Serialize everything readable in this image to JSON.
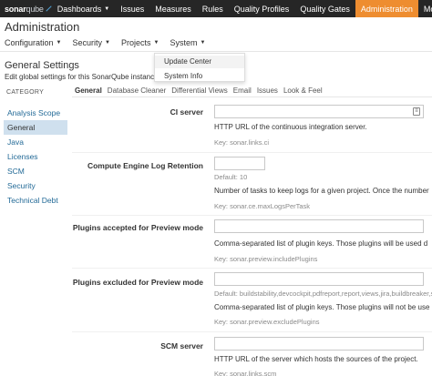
{
  "topnav": {
    "logo_main": "sonar",
    "logo_sub": "qube",
    "items": [
      {
        "label": "Dashboards",
        "caret": true
      },
      {
        "label": "Issues",
        "caret": false
      },
      {
        "label": "Measures",
        "caret": false
      },
      {
        "label": "Rules",
        "caret": false
      },
      {
        "label": "Quality Profiles",
        "caret": false
      },
      {
        "label": "Quality Gates",
        "caret": false
      },
      {
        "label": "Administration",
        "caret": false,
        "active": true
      },
      {
        "label": "More",
        "caret": true
      }
    ]
  },
  "header": {
    "title": "Administration",
    "subnav": [
      "Configuration",
      "Security",
      "Projects",
      "System"
    ]
  },
  "dropdown": {
    "items": [
      "Update Center",
      "System Info"
    ]
  },
  "settings": {
    "title": "General Settings",
    "description": "Edit global settings for this SonarQube instance."
  },
  "sidebar": {
    "category_label": "CATEGORY",
    "items": [
      "Analysis Scope",
      "General",
      "Java",
      "Licenses",
      "SCM",
      "Security",
      "Technical Debt"
    ]
  },
  "tabs": [
    "General",
    "Database Cleaner",
    "Differential Views",
    "Email",
    "Issues",
    "Look & Feel"
  ],
  "rows": [
    {
      "label": "CI server",
      "help": "HTTP URL of the continuous integration server.",
      "key": "Key: sonar.links.ci"
    },
    {
      "label": "Compute Engine Log Retention",
      "default": "Default: 10",
      "help": "Number of tasks to keep logs for a given project. Once the number",
      "key": "Key: sonar.ce.maxLogsPerTask"
    },
    {
      "label": "Plugins accepted for Preview mode",
      "help": "Comma-separated list of plugin keys. Those plugins will be used d",
      "key": "Key: sonar.preview.includePlugins"
    },
    {
      "label": "Plugins excluded for Preview mode",
      "default": "Default: buildstability,devcockpit,pdfreport,report,views,jira,buildbreaker,sc",
      "help": "Comma-separated list of plugin keys. Those plugins will not be use",
      "key": "Key: sonar.preview.excludePlugins"
    },
    {
      "label": "SCM server",
      "help": "HTTP URL of the server which hosts the sources of the project.",
      "key": "Key: sonar.links.scm"
    }
  ],
  "colors": {
    "nav_bg": "#262626",
    "accent": "#ee8d30",
    "link": "#236a97",
    "sidebar_active": "#cfe0ee"
  }
}
